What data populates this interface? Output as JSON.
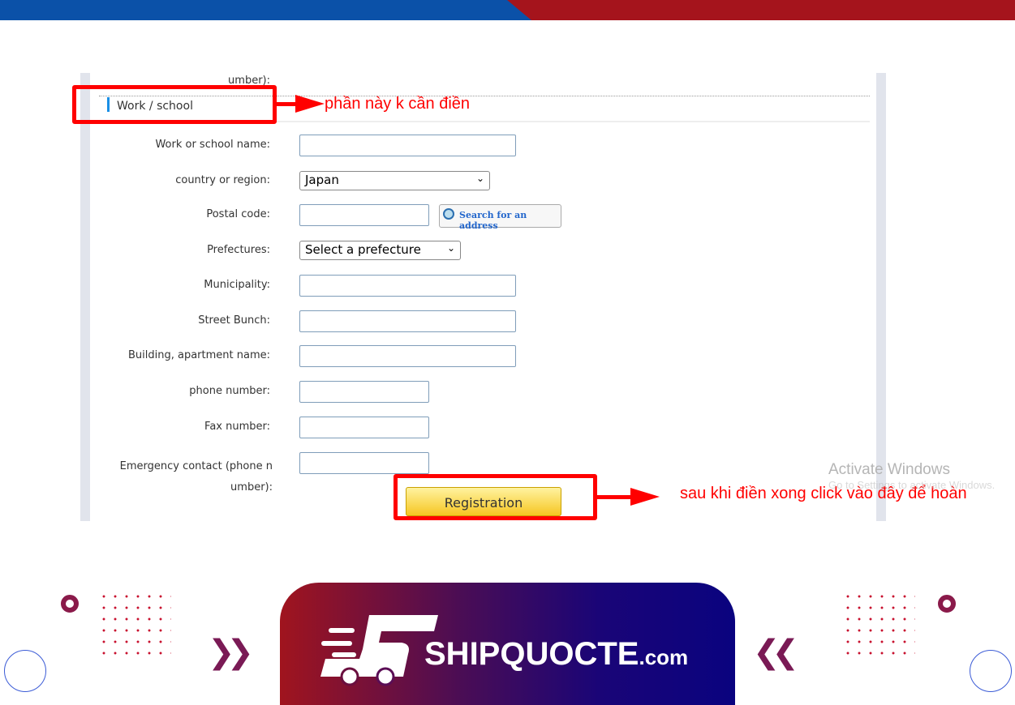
{
  "section": {
    "title": "Work / school",
    "prev_label_tail": "umber):"
  },
  "form": {
    "work_name": {
      "label": "Work or school name:",
      "value": ""
    },
    "country": {
      "label": "country or region:",
      "value": "Japan"
    },
    "postal": {
      "label": "Postal code:",
      "value": "",
      "search_button": "Search for an address"
    },
    "prefecture": {
      "label": "Prefectures:",
      "value": "Select a prefecture"
    },
    "municipality": {
      "label": "Municipality:",
      "value": ""
    },
    "street": {
      "label": "Street Bunch:",
      "value": ""
    },
    "building": {
      "label": "Building, apartment name:",
      "value": ""
    },
    "phone": {
      "label": "phone number:",
      "value": ""
    },
    "fax": {
      "label": "Fax number:",
      "value": ""
    },
    "emergency": {
      "label_line1": "Emergency contact (phone n",
      "label_line2": "umber):",
      "value": ""
    },
    "submit": "Registration"
  },
  "annotations": {
    "section_note": "phần này k cần điền",
    "submit_note": "sau khi điền xong click vào đây để hoàn"
  },
  "watermark": {
    "line1": "Activate Windows",
    "line2": "Go to Settings to activate Windows."
  },
  "brand": {
    "name": "SHIPQUOCTE",
    "suffix": ".com",
    "colors": {
      "red": "#a5141c",
      "blue": "#0b51a8",
      "navy": "#0a037f"
    }
  }
}
